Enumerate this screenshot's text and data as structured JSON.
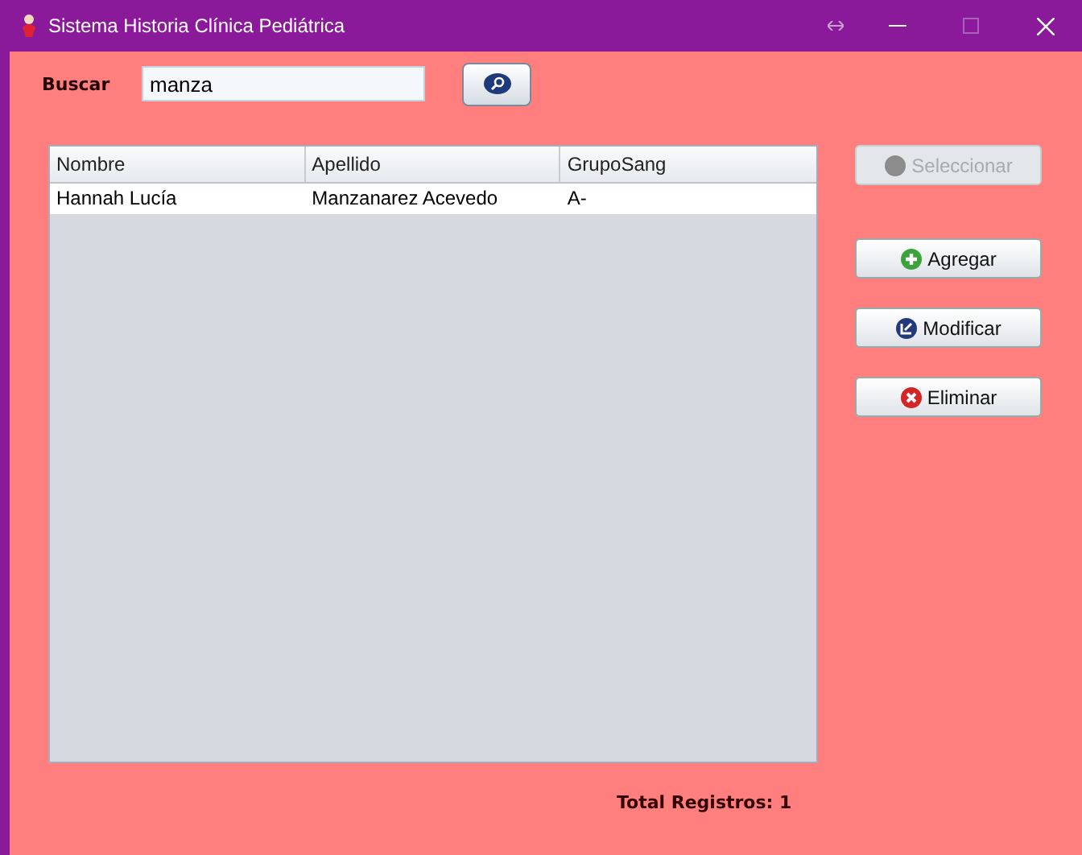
{
  "window": {
    "title": "Sistema Historia Clínica Pediátrica"
  },
  "search": {
    "label": "Buscar",
    "value": "manza"
  },
  "table": {
    "columns": [
      "Nombre",
      "Apellido",
      "GrupoSang"
    ],
    "rows": [
      [
        "Hannah Lucía",
        "Manzanarez Acevedo",
        "A-"
      ]
    ]
  },
  "actions": [
    {
      "label": "Seleccionar",
      "kind": "select",
      "disabled": true
    },
    {
      "label": "Agregar",
      "kind": "add",
      "disabled": false
    },
    {
      "label": "Modificar",
      "kind": "edit",
      "disabled": false
    },
    {
      "label": "Eliminar",
      "kind": "delete",
      "disabled": false
    }
  ],
  "status_bar": {
    "total": "Total Registros: 1"
  }
}
